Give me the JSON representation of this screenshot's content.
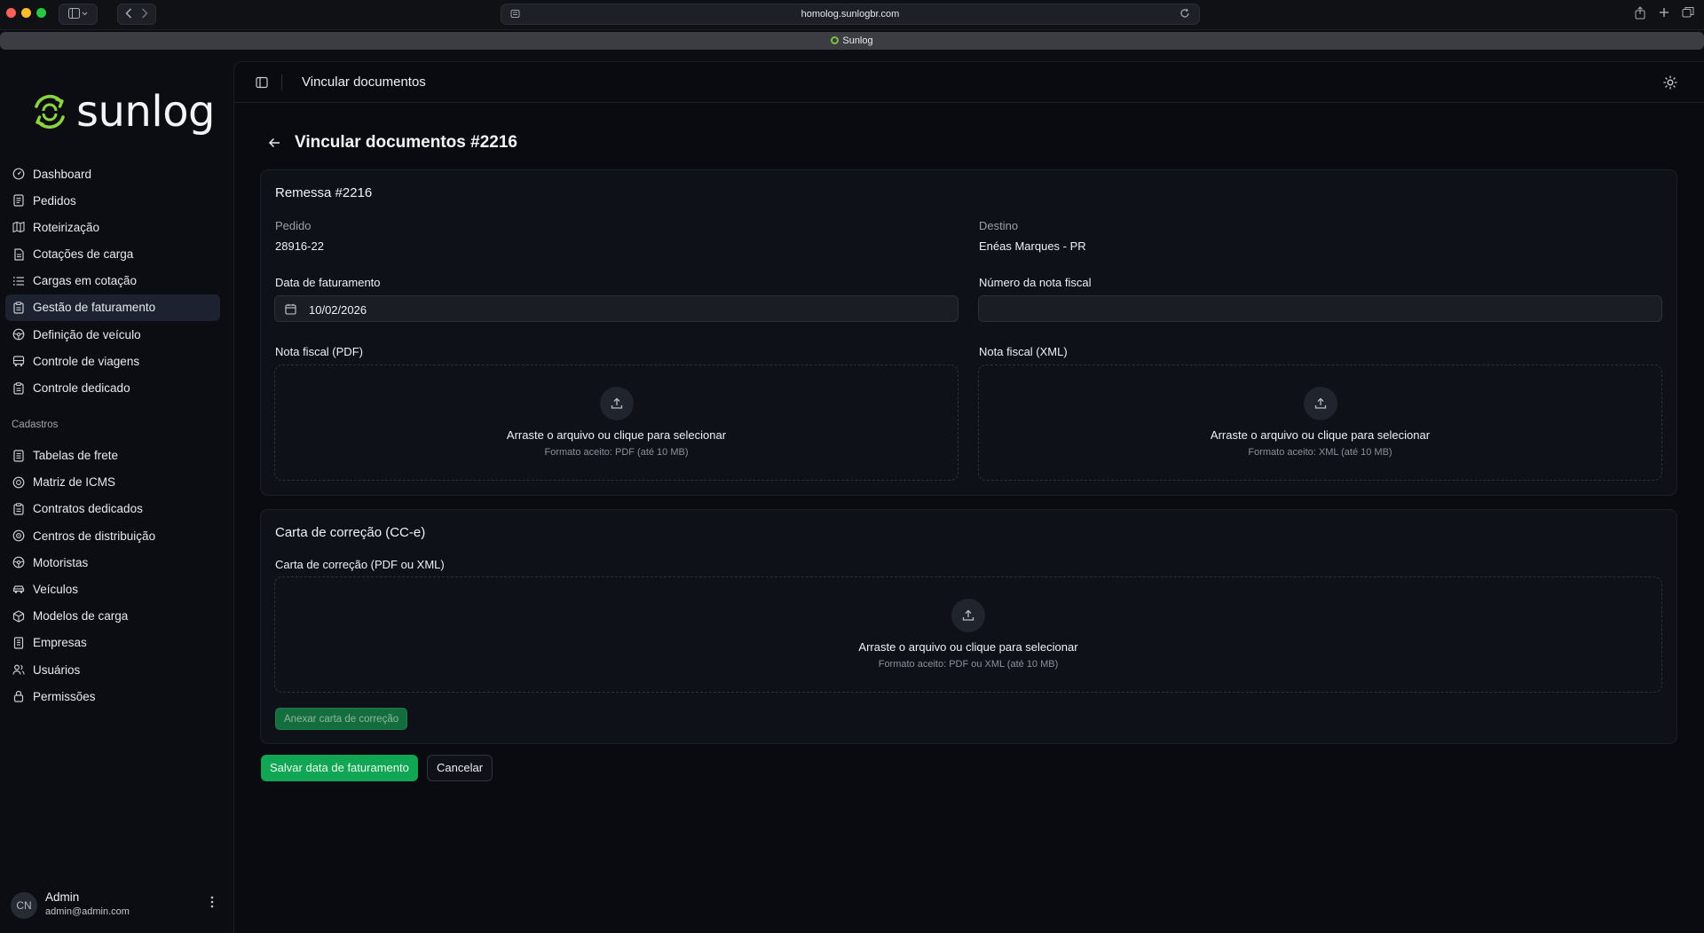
{
  "browser": {
    "url": "homolog.sunlogbr.com",
    "tab_title": "Sunlog"
  },
  "brand": {
    "name": "sunlog",
    "accent": "#8bd43f",
    "primary_green": "#11a653"
  },
  "sidebar": {
    "items": [
      {
        "label": "Dashboard",
        "icon": "dashboard-icon"
      },
      {
        "label": "Pedidos",
        "icon": "orders-icon"
      },
      {
        "label": "Roteirização",
        "icon": "map-icon"
      },
      {
        "label": "Cotações de carga",
        "icon": "document-icon"
      },
      {
        "label": "Cargas em cotação",
        "icon": "list-icon"
      },
      {
        "label": "Gestão de faturamento",
        "icon": "clipboard-icon",
        "active": true
      },
      {
        "label": "Definição de veículo",
        "icon": "steering-wheel-icon"
      },
      {
        "label": "Controle de viagens",
        "icon": "bus-icon"
      },
      {
        "label": "Controle dedicado",
        "icon": "clipboard-icon"
      }
    ],
    "section_label": "Cadastros",
    "cadastros": [
      {
        "label": "Tabelas de frete",
        "icon": "table-icon"
      },
      {
        "label": "Matriz de ICMS",
        "icon": "target-icon"
      },
      {
        "label": "Contratos dedicados",
        "icon": "clipboard-icon"
      },
      {
        "label": "Centros de distribuição",
        "icon": "location-icon"
      },
      {
        "label": "Motoristas",
        "icon": "steering-wheel-icon"
      },
      {
        "label": "Veículos",
        "icon": "car-icon"
      },
      {
        "label": "Modelos de carga",
        "icon": "box-icon"
      },
      {
        "label": "Empresas",
        "icon": "building-icon"
      },
      {
        "label": "Usuários",
        "icon": "users-icon"
      },
      {
        "label": "Permissões",
        "icon": "lock-icon"
      }
    ],
    "user": {
      "initials": "CN",
      "name": "Admin",
      "email": "admin@admin.com"
    }
  },
  "header": {
    "title": "Vincular documentos"
  },
  "page": {
    "title": "Vincular documentos #2216",
    "remessa": {
      "title": "Remessa #2216",
      "pedido_label": "Pedido",
      "pedido_value": "28916-22",
      "destino_label": "Destino",
      "destino_value": "Enéas Marques - PR",
      "data_label": "Data de faturamento",
      "data_value": "10/02/2026",
      "nota_label": "Número da nota fiscal",
      "nota_value": "",
      "pdf_label": "Nota fiscal (PDF)",
      "xml_label": "Nota fiscal (XML)",
      "dropzone_text": "Arraste o arquivo ou clique para selecionar",
      "pdf_format": "Formato aceito: PDF (até 10 MB)",
      "xml_format": "Formato aceito: XML (até 10 MB)"
    },
    "carta": {
      "title": "Carta de correção (CC-e)",
      "field_label": "Carta de correção (PDF ou XML)",
      "dropzone_text": "Arraste o arquivo ou clique para selecionar",
      "format": "Formato aceito: PDF ou XML (até 10 MB)",
      "attach_label": "Anexar carta de correção"
    },
    "save_label": "Salvar data de faturamento",
    "cancel_label": "Cancelar"
  }
}
